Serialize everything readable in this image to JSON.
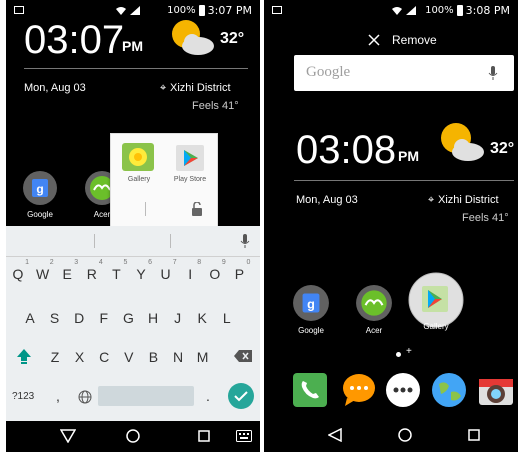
{
  "left": {
    "status": {
      "battery": "100%",
      "time": "3:07 PM"
    },
    "widget": {
      "clock": "03:07",
      "ampm": "PM",
      "temp": "32°",
      "date": "Mon, Aug 03",
      "location": "Xizhi District",
      "feels": "Feels 41°"
    },
    "apps": [
      {
        "label": "Google"
      },
      {
        "label": "Acer"
      }
    ],
    "popup": {
      "items": [
        {
          "label": "Gallery"
        },
        {
          "label": "Play Store"
        }
      ]
    },
    "keyboard": {
      "row1": [
        "Q",
        "W",
        "E",
        "R",
        "T",
        "Y",
        "U",
        "I",
        "O",
        "P"
      ],
      "row1_hints": [
        "1",
        "2",
        "3",
        "4",
        "5",
        "6",
        "7",
        "8",
        "9",
        "0"
      ],
      "row2": [
        "A",
        "S",
        "D",
        "F",
        "G",
        "H",
        "J",
        "K",
        "L"
      ],
      "row3": [
        "Z",
        "X",
        "C",
        "V",
        "B",
        "N",
        "M"
      ],
      "symbols_key": "?123",
      "comma_key": ",",
      "period_key": "."
    }
  },
  "right": {
    "status": {
      "battery": "100%",
      "time": "3:08 PM"
    },
    "remove_label": "Remove",
    "search_placeholder": "Google",
    "widget": {
      "clock": "03:08",
      "ampm": "PM",
      "temp": "32°",
      "date": "Mon, Aug 03",
      "location": "Xizhi District",
      "feels": "Feels 41°"
    },
    "apps": [
      {
        "label": "Google"
      },
      {
        "label": "Acer"
      },
      {
        "label": "Gallery"
      }
    ],
    "page_indicator_plus": "+",
    "dock": [
      {
        "icon": "phone-icon"
      },
      {
        "icon": "messaging-icon"
      },
      {
        "icon": "app-drawer-icon"
      },
      {
        "icon": "browser-icon"
      },
      {
        "icon": "camera-icon"
      }
    ]
  },
  "colors": {
    "google_blue": "#4285f4",
    "acer_green": "#6bbf2a",
    "phone_green": "#4caf50",
    "msg_orange": "#ff9800",
    "enter_teal": "#26a69a",
    "shift_teal": "#009688"
  }
}
